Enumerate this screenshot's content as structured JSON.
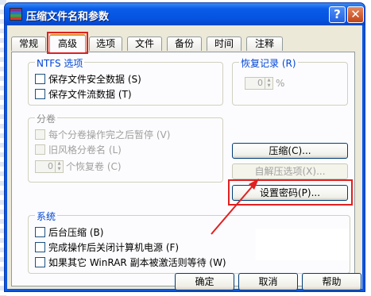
{
  "window": {
    "title": "压缩文件名和参数",
    "help_glyph": "?",
    "close_glyph": "✕"
  },
  "tabs": [
    {
      "label": "常规"
    },
    {
      "label": "高级"
    },
    {
      "label": "选项"
    },
    {
      "label": "文件"
    },
    {
      "label": "备份"
    },
    {
      "label": "时间"
    },
    {
      "label": "注释"
    }
  ],
  "active_tab": "高级",
  "ntfs": {
    "label": "NTFS 选项",
    "options": [
      {
        "label": "保存文件安全数据 (S)",
        "checked": false
      },
      {
        "label": "保存文件流数据 (T)",
        "checked": false
      }
    ]
  },
  "recovery": {
    "label": "恢复记录 (R)",
    "value": "0",
    "unit": "%"
  },
  "volumes": {
    "label": "分卷",
    "options": [
      {
        "label": "每个分卷操作完之后暂停 (V)",
        "checked": false
      },
      {
        "label": "旧风格分卷名 (L)",
        "checked": false
      }
    ],
    "recovery_value": "0",
    "recovery_label": "个恢复卷 (C)"
  },
  "buttons": {
    "compress": "压缩(C)...",
    "sfx_options": "自解压选项(X)...",
    "set_password": "设置密码(P)..."
  },
  "system": {
    "label": "系统",
    "options": [
      {
        "label": "后台压缩 (B)",
        "checked": false
      },
      {
        "label": "完成操作后关闭计算机电源 (F)",
        "checked": false
      },
      {
        "label": "如果其它 WinRAR 副本被激活则等待 (W)",
        "checked": false
      }
    ]
  },
  "footer": {
    "ok": "确定",
    "cancel": "取消",
    "help": "帮助"
  },
  "colors": {
    "highlight": "#e02020",
    "group_label": "#0046d5",
    "titlebar": "#0553e0"
  },
  "icons": [
    "winrar-app-icon",
    "help-icon",
    "close-icon",
    "spin-arrows-icon",
    "annotation-arrow"
  ]
}
